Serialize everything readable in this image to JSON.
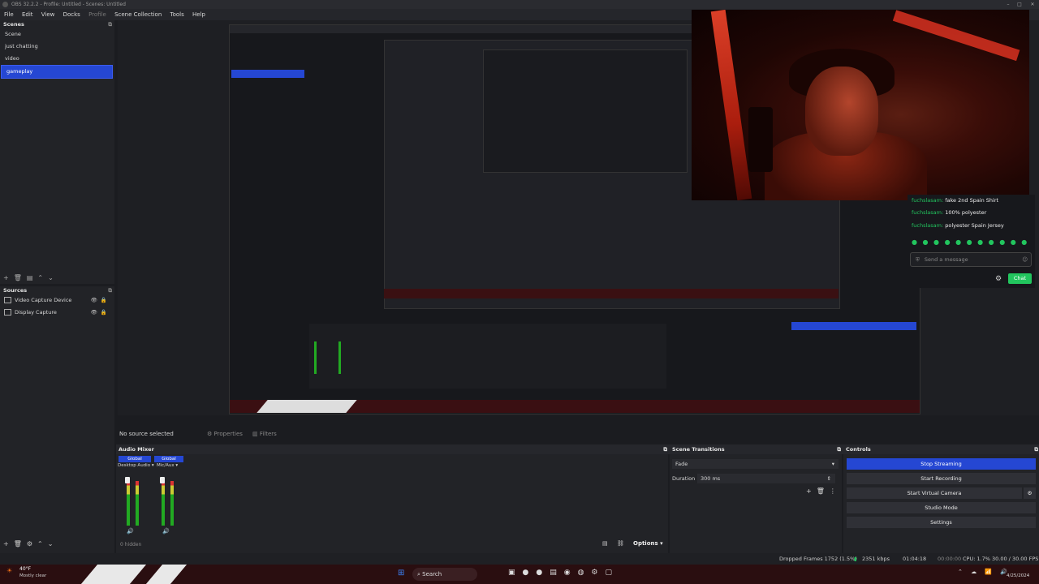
{
  "window": {
    "title": "OBS 32.2.2 - Profile: Untitled - Scenes: Untitled"
  },
  "menu": [
    "File",
    "Edit",
    "View",
    "Docks",
    "Profile",
    "Scene Collection",
    "Tools",
    "Help"
  ],
  "scenes": {
    "title": "Scenes",
    "items": [
      "Scene",
      "just chatting",
      "video",
      "gameplay"
    ],
    "selected": 3
  },
  "sources": {
    "title": "Sources",
    "items": [
      "Video Capture Device",
      "Display Capture"
    ]
  },
  "chat": {
    "lines": [
      {
        "user": "fuchslasam:",
        "text": "fake 2nd Spain Shirt"
      },
      {
        "user": "fuchslasam:",
        "text": "100% polyester"
      },
      {
        "user": "fuchslasam:",
        "text": "polyester Spain Jersey"
      }
    ],
    "placeholder": "Send a message",
    "send": "Chat"
  },
  "props": {
    "no_source": "No source selected",
    "properties": "Properties",
    "filters": "Filters"
  },
  "mixer": {
    "title": "Audio Mixer",
    "tracks": [
      {
        "tag": "Global",
        "name": "Desktop Audio"
      },
      {
        "tag": "Global",
        "name": "Mic/Aux"
      }
    ],
    "hidden": "0 hidden"
  },
  "transitions": {
    "title": "Scene Transitions",
    "type": "Fade",
    "duration_label": "Duration",
    "duration": "300 ms"
  },
  "controls": {
    "title": "Controls",
    "buttons": [
      "Stop Streaming",
      "Start Recording",
      "Start Virtual Camera",
      "Studio Mode",
      "Settings"
    ]
  },
  "footer": {
    "options": "Options"
  },
  "status": {
    "dropped": "Dropped Frames 1752 (1.5%)",
    "kbps": "2351 kbps",
    "live": "01:04:18",
    "rec": "00:00:00",
    "cpu": "CPU: 1.7%",
    "fps": "30.00 / 30.00 FPS"
  },
  "taskbar": {
    "weather_temp": "40°F",
    "weather_desc": "Mostly clear",
    "search": "Search",
    "date": "4/25/2024"
  },
  "colors": {
    "accent": "#2547d3",
    "chat_green": "#22c55e"
  }
}
